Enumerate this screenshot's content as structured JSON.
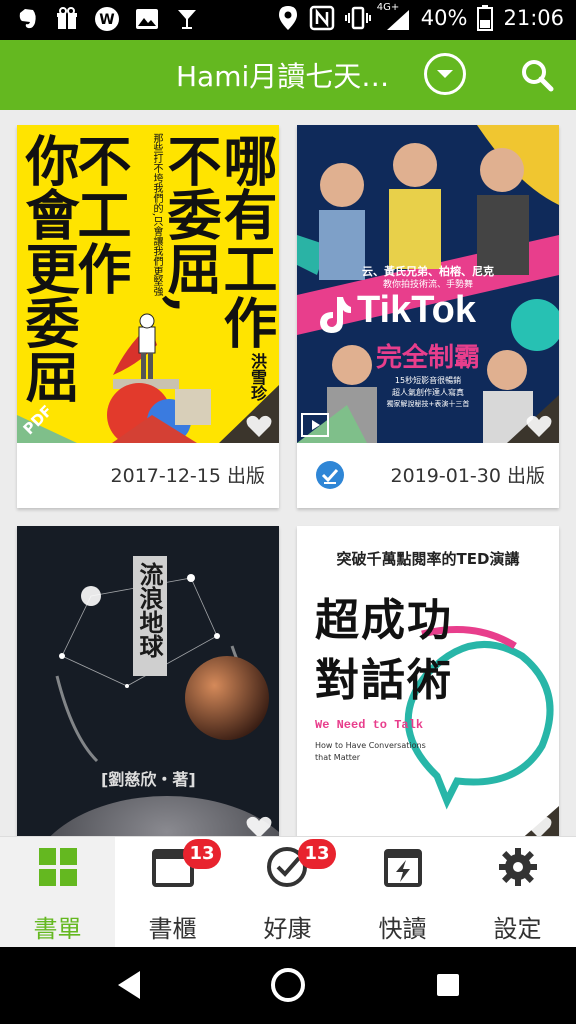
{
  "status_bar": {
    "network": "4G+",
    "battery": "40%",
    "time": "21:06"
  },
  "app_bar": {
    "title": "Hami月讀七天…"
  },
  "books": [
    {
      "cover_text": [
        "你會更委屈",
        "不工作",
        "不委屈,",
        "哪有工作"
      ],
      "cover_subtext": "那些打不垮我們的,只會讓我們更堅強",
      "author": "洪雪珍",
      "format": "PDF",
      "date": "2017-12-15 出版"
    },
    {
      "cover_tagline": "云、黃氏兄弟、柏榕、尼克",
      "cover_tagline2": "教你拍技術流、手勢舞",
      "cover_title": "TikTok",
      "cover_subtitle": "完全制霸",
      "cover_line1": "15秒短影音很暢銷",
      "cover_line2": "超人氣創作達人寫真",
      "cover_line3": "獨家解說秘技+表演十三首",
      "date": "2019-01-30 出版"
    },
    {
      "cover_title": "流浪地球",
      "author": "[劉慈欣・著]"
    },
    {
      "cover_top": "突破千萬點閱率的TED演講",
      "cover_title_line1": "超成功",
      "cover_title_line2": "對話術",
      "cover_en": "We Need to Talk",
      "cover_en_sub1": "How to Have Conversations",
      "cover_en_sub2": "that Matter"
    }
  ],
  "bottom_nav": {
    "items": [
      {
        "label": "書單",
        "active": true
      },
      {
        "label": "書櫃",
        "badge": "13"
      },
      {
        "label": "好康",
        "badge": "13"
      },
      {
        "label": "快讀"
      },
      {
        "label": "設定"
      }
    ]
  },
  "colors": {
    "brand_green": "#64b820",
    "badge_red": "#e8232e",
    "tiktok_navy": "#0f2a5a",
    "check_blue": "#2f86d6"
  }
}
